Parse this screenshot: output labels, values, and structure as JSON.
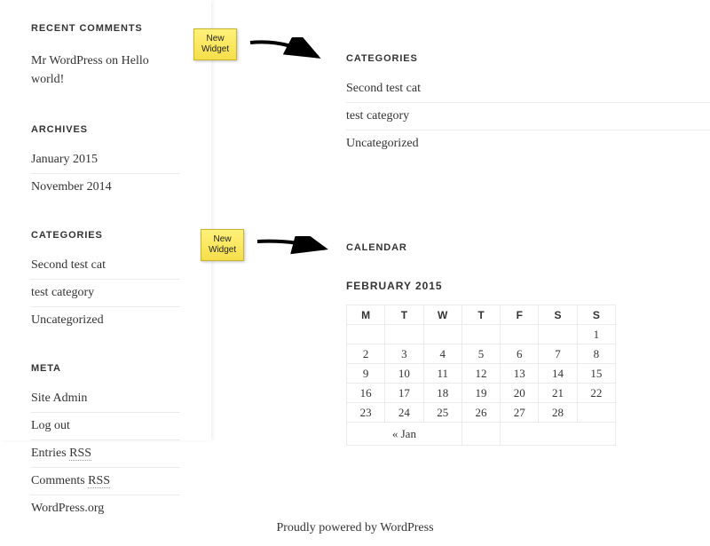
{
  "sidebar": {
    "recent_comments": {
      "title": "RECENT COMMENTS",
      "author": "Mr WordPress",
      "on": " on ",
      "target": "Hello world!"
    },
    "archives": {
      "title": "ARCHIVES",
      "items": [
        "January 2015",
        "November 2014"
      ]
    },
    "categories": {
      "title": "CATEGORIES",
      "items": [
        "Second test cat",
        "test category",
        "Uncategorized"
      ]
    },
    "meta": {
      "title": "META",
      "site_admin": "Site Admin",
      "logout": "Log out",
      "entries": "Entries ",
      "entries_rss": "RSS",
      "comments": "Comments ",
      "comments_rss": "RSS",
      "wporg": "WordPress.org"
    }
  },
  "main": {
    "categories": {
      "title": "CATEGORIES",
      "items": [
        "Second test cat",
        "test category",
        "Uncategorized"
      ]
    },
    "calendar": {
      "title": "CALENDAR",
      "caption": "FEBRUARY 2015",
      "weekdays": [
        "M",
        "T",
        "W",
        "T",
        "F",
        "S",
        "S"
      ],
      "rows": [
        [
          "",
          "",
          "",
          "",
          "",
          "",
          "1"
        ],
        [
          "2",
          "3",
          "4",
          "5",
          "6",
          "7",
          "8"
        ],
        [
          "9",
          "10",
          "11",
          "12",
          "13",
          "14",
          "15"
        ],
        [
          "16",
          "17",
          "18",
          "19",
          "20",
          "21",
          "22"
        ],
        [
          "23",
          "24",
          "25",
          "26",
          "27",
          "28",
          ""
        ]
      ],
      "prev": "« Jan"
    }
  },
  "callouts": {
    "note1": "New\nWidget",
    "note2": "New\nWidget"
  },
  "footer": {
    "text": "Proudly powered by WordPress"
  }
}
